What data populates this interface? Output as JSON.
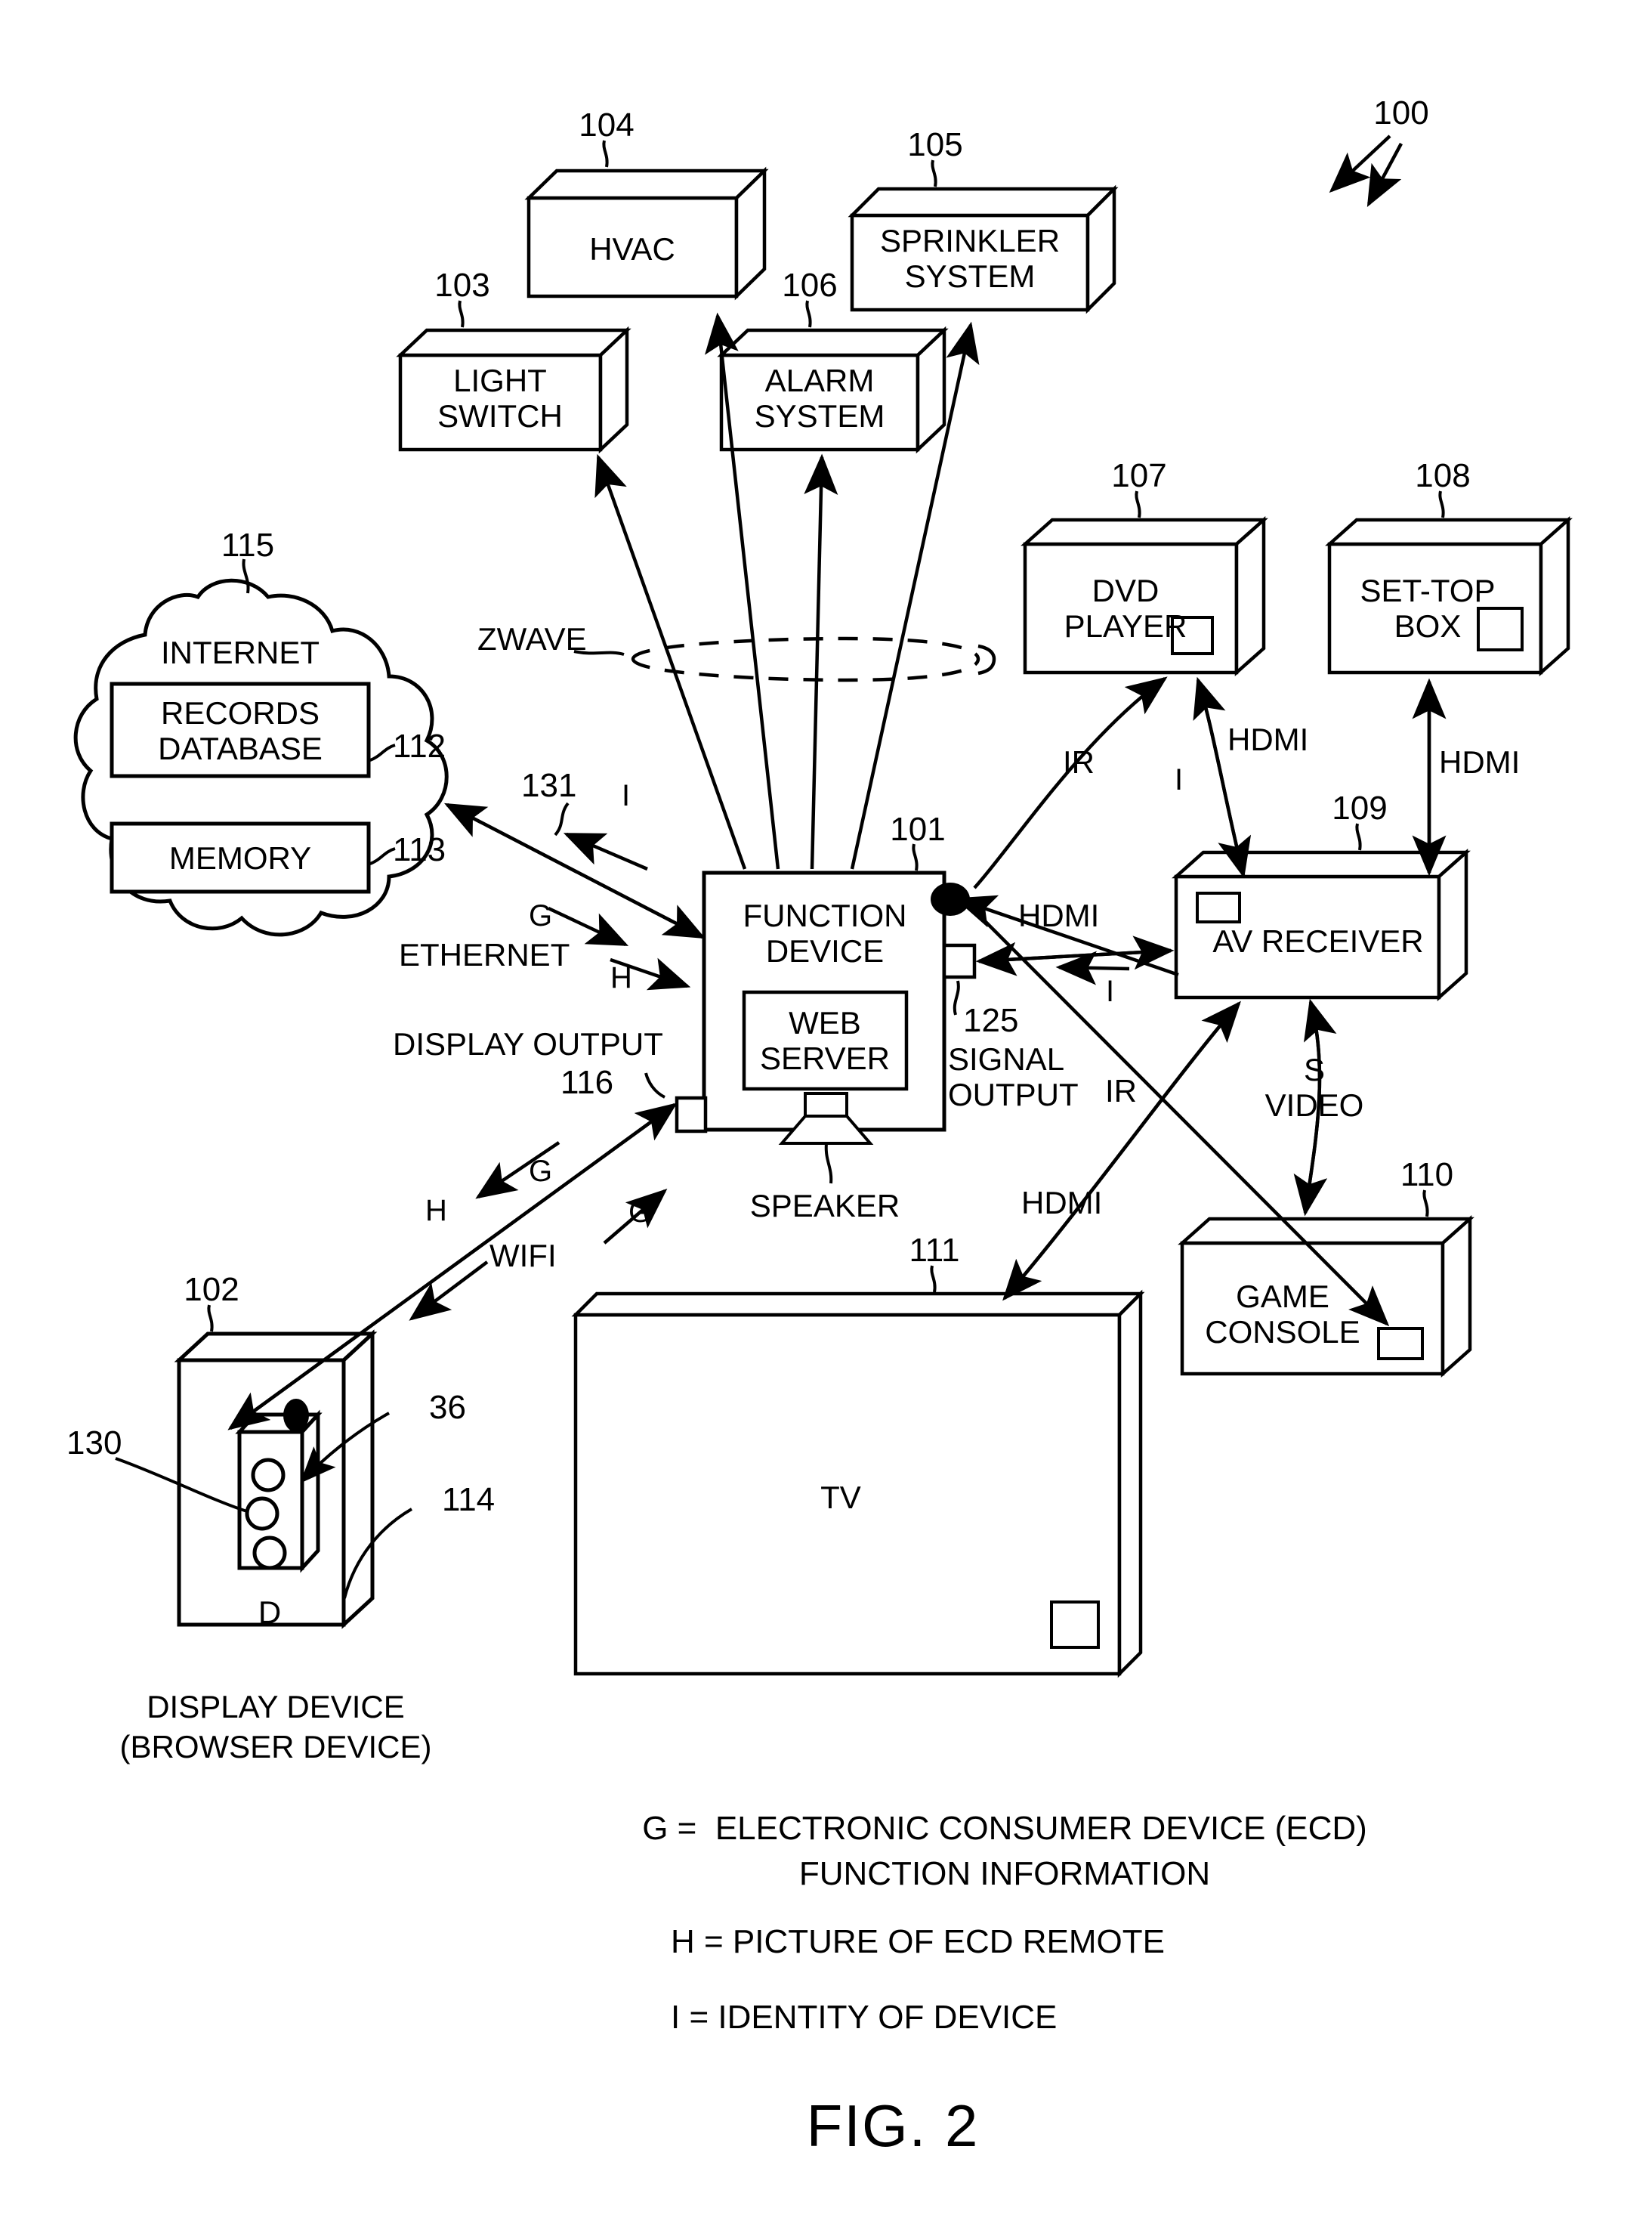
{
  "figure": {
    "caption": "FIG. 2",
    "system_ref": "100"
  },
  "blocks": [
    {
      "id": "hvac",
      "label": "HVAC",
      "ref": "104"
    },
    {
      "id": "sprinkler",
      "label": "SPRINKLER\nSYSTEM",
      "ref": "105"
    },
    {
      "id": "light_switch",
      "label": "LIGHT\nSWITCH",
      "ref": "103"
    },
    {
      "id": "alarm",
      "label": "ALARM\nSYSTEM",
      "ref": "106"
    },
    {
      "id": "dvd",
      "label": "DVD\nPLAYER",
      "ref": "107"
    },
    {
      "id": "settop",
      "label": "SET-TOP\nBOX",
      "ref": "108"
    },
    {
      "id": "avreceiver",
      "label": "AV RECEIVER",
      "ref": "109"
    },
    {
      "id": "gameconsole",
      "label": "GAME\nCONSOLE",
      "ref": "110"
    },
    {
      "id": "tv",
      "label": "TV",
      "ref": "111"
    },
    {
      "id": "function_device",
      "label": "FUNCTION\nDEVICE",
      "ref": "101"
    },
    {
      "id": "web_server",
      "label": "WEB\nSERVER",
      "ref": ""
    },
    {
      "id": "display_device",
      "label": "D",
      "ref": "102"
    }
  ],
  "cloud": {
    "title": "INTERNET",
    "ref": "115",
    "items": [
      {
        "label": "RECORDS\nDATABASE",
        "ref": "112"
      },
      {
        "label": "MEMORY",
        "ref": "113"
      }
    ]
  },
  "function_device": {
    "title": "FUNCTION\nDEVICE",
    "ref": "101",
    "web_server": "WEB\nSERVER",
    "speaker_label": "SPEAKER",
    "signal_output_label": "SIGNAL\nOUTPUT",
    "signal_output_ref": "125",
    "display_output_label": "DISPLAY OUTPUT",
    "display_output_ref": "116"
  },
  "display_device": {
    "face_label": "D",
    "ref": "102",
    "caption_line1": "DISPLAY DEVICE",
    "caption_line2": "(BROWSER DEVICE)",
    "remote_ref": "36",
    "button_ref": "130",
    "body_ref": "114"
  },
  "network_labels": {
    "zwave": "ZWAVE",
    "ethernet": "ETHERNET",
    "wifi": "WIFI",
    "ethernet_link_ref": "131"
  },
  "signal_labels": {
    "hdmi": "HDMI",
    "ir": "IR",
    "svideo": "S\nVIDEO",
    "g": "G",
    "h": "H",
    "i": "I"
  },
  "legend": [
    {
      "key": "G = ",
      "text": "ELECTRONIC CONSUMER DEVICE (ECD)",
      "text2": "FUNCTION INFORMATION"
    },
    {
      "key": "H = ",
      "text": "PICTURE OF ECD REMOTE",
      "text2": ""
    },
    {
      "key": "I = ",
      "text": "IDENTITY OF DEVICE",
      "text2": ""
    }
  ],
  "legend_lines": {
    "l1a": "G =  ELECTRONIC CONSUMER DEVICE (ECD)",
    "l1b": "FUNCTION INFORMATION",
    "l2": "H = PICTURE OF ECD REMOTE",
    "l3": "I = IDENTITY OF DEVICE"
  },
  "colors": {
    "ink": "#000000",
    "paper": "#ffffff"
  }
}
